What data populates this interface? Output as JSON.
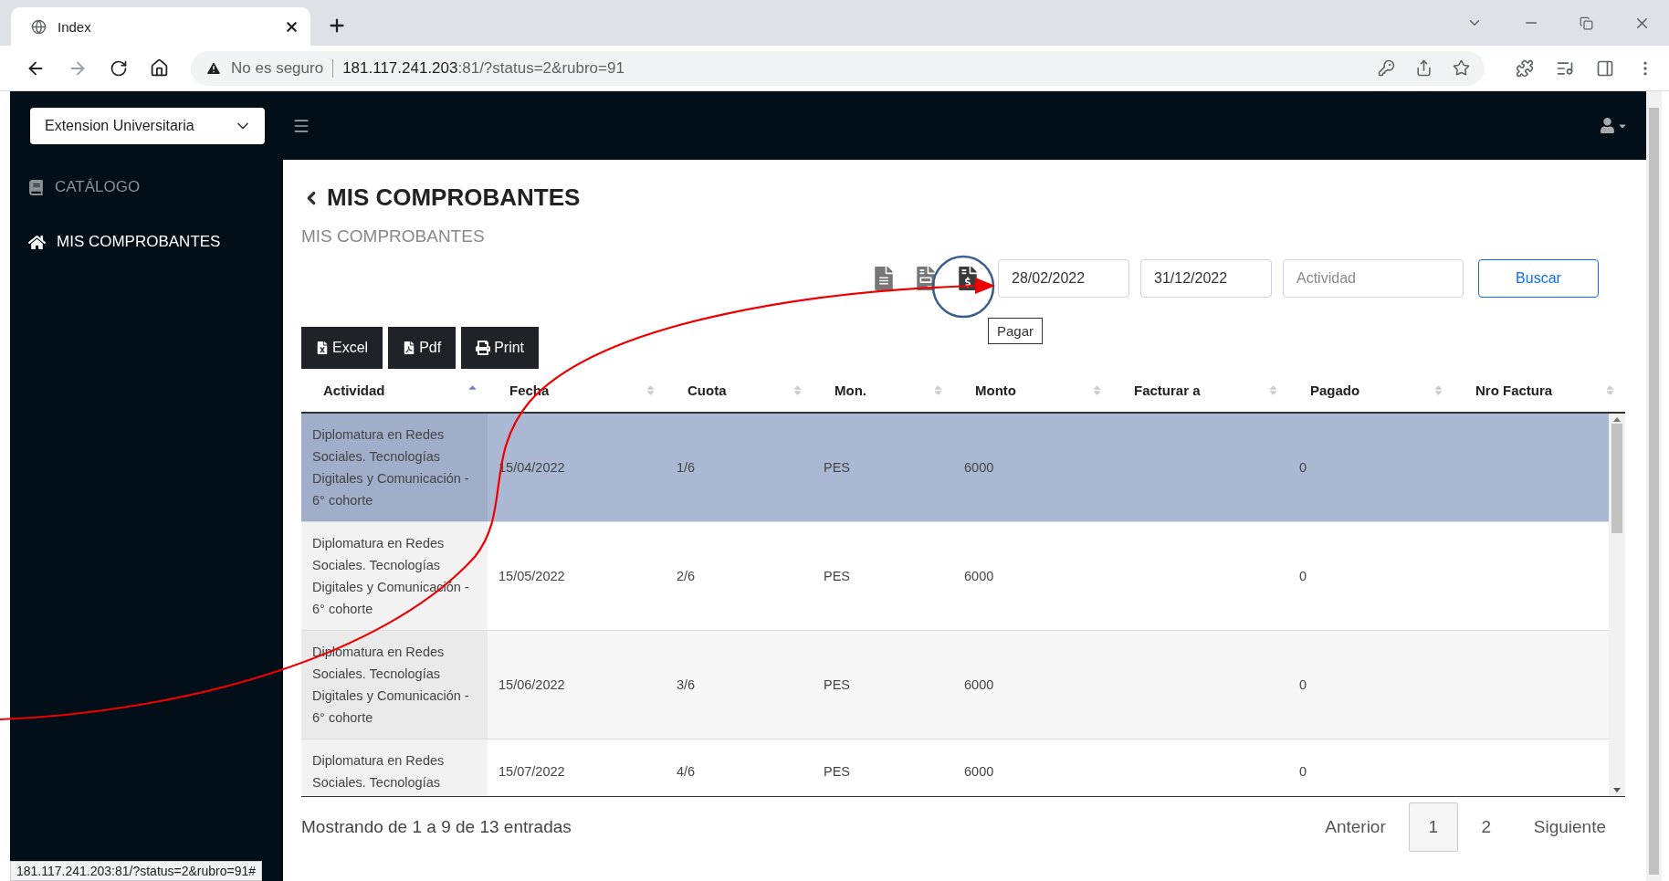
{
  "browser": {
    "tab_title": "Index",
    "security": "No es seguro",
    "url_host": "181.117.241.203",
    "url_rest": ":81/?status=2&rubro=91"
  },
  "header": {
    "selector": "Extension Universitaria"
  },
  "sidebar": {
    "items": [
      {
        "label": "CATÁLOGO",
        "kind": "book",
        "selected": false
      },
      {
        "label": "MIS COMPROBANTES",
        "kind": "home",
        "selected": true
      }
    ]
  },
  "page": {
    "title": "MIS COMPROBANTES",
    "subtitle": "MIS COMPROBANTES"
  },
  "doc_actions": [
    {
      "kind": "document",
      "selected": false
    },
    {
      "kind": "invoice",
      "selected": false
    },
    {
      "kind": "pay",
      "selected": true
    }
  ],
  "filters": {
    "date_from": "28/02/2022",
    "date_to": "31/12/2022",
    "activity_placeholder": "Actividad",
    "search_button": "Buscar",
    "tooltip": "Pagar"
  },
  "exports": [
    {
      "kind": "excel",
      "label": "Excel"
    },
    {
      "kind": "pdf",
      "label": "Pdf"
    },
    {
      "kind": "print",
      "label": "Print"
    }
  ],
  "table": {
    "columns": [
      {
        "label": "Actividad",
        "sorted": true
      },
      {
        "label": "Fecha",
        "sorted": false
      },
      {
        "label": "Cuota",
        "sorted": false
      },
      {
        "label": "Mon.",
        "sorted": false
      },
      {
        "label": "Monto",
        "sorted": false
      },
      {
        "label": "Facturar a",
        "sorted": false
      },
      {
        "label": "Pagado",
        "sorted": false
      },
      {
        "label": "Nro Factura",
        "sorted": false
      }
    ],
    "rows": [
      {
        "selected": true,
        "actividad": "Diplomatura en Redes Sociales. Tecnologías Digitales y Comunicación - 6° cohorte",
        "fecha": "15/04/2022",
        "cuota": "1/6",
        "mon": "PES",
        "monto": "6000",
        "pagado": "0"
      },
      {
        "selected": false,
        "actividad": "Diplomatura en Redes Sociales. Tecnologías Digitales y Comunicación - 6° cohorte",
        "fecha": "15/05/2022",
        "cuota": "2/6",
        "mon": "PES",
        "monto": "6000",
        "pagado": "0"
      },
      {
        "selected": false,
        "actividad": "Diplomatura en Redes Sociales. Tecnologías Digitales y Comunicación - 6° cohorte",
        "fecha": "15/06/2022",
        "cuota": "3/6",
        "mon": "PES",
        "monto": "6000",
        "pagado": "0"
      },
      {
        "selected": false,
        "actividad": "Diplomatura en Redes Sociales. Tecnologías",
        "fecha": "15/07/2022",
        "cuota": "4/6",
        "mon": "PES",
        "monto": "6000",
        "pagado": "0"
      }
    ]
  },
  "footer": {
    "summary": "Mostrando de 1 a 9 de 13 entradas",
    "pagination": [
      {
        "label": "Anterior",
        "selected": false
      },
      {
        "label": "1",
        "selected": true
      },
      {
        "label": "2",
        "selected": false
      },
      {
        "label": "Siguiente",
        "selected": false
      }
    ]
  },
  "status_url": "181.117.241.203:81/?status=2&rubro=91#"
}
